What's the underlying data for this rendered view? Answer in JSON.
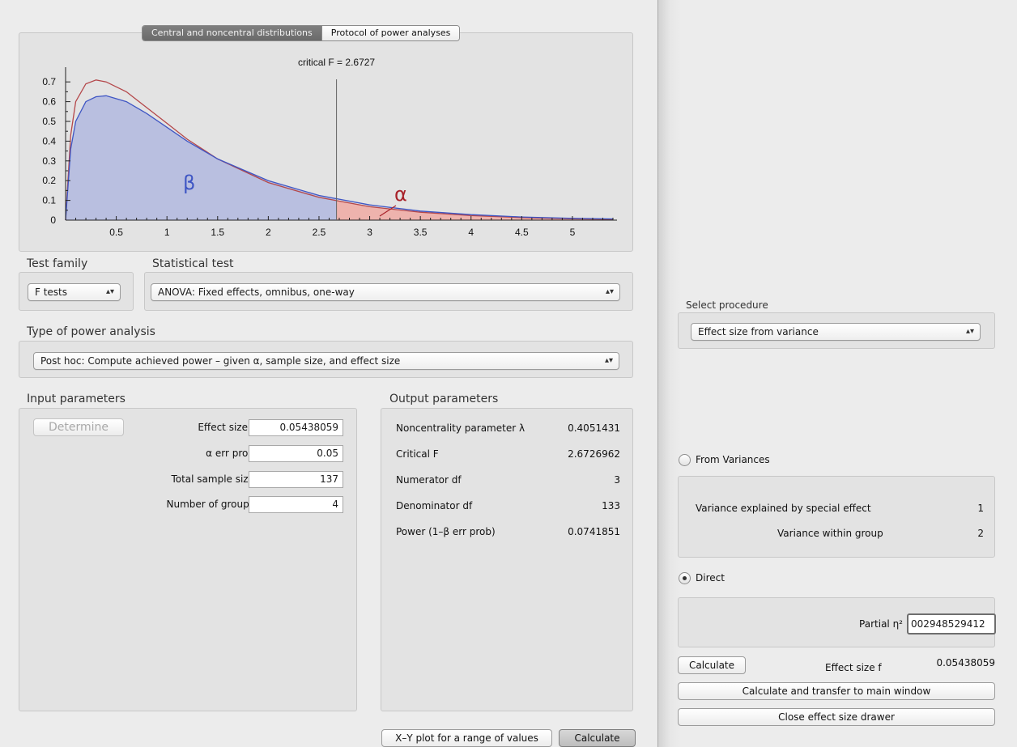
{
  "plot": {
    "tabs": [
      "Central and noncentral distributions",
      "Protocol of power analyses"
    ],
    "critical_label": "critical F = 2.6727",
    "beta_symbol": "β",
    "alpha_symbol": "α",
    "colors": {
      "central_curve": "#b4474a",
      "noncentral_curve": "#3f56c4",
      "beta_fill": "#b9bfe0",
      "alpha_fill": "#eeb3ad"
    }
  },
  "chart_data": {
    "type": "area",
    "title": "",
    "xlabel": "",
    "ylabel": "",
    "xlim": [
      0,
      5.4
    ],
    "ylim": [
      0,
      0.75
    ],
    "x_ticks": [
      "0.5",
      "1",
      "1.5",
      "2",
      "2.5",
      "3",
      "3.5",
      "4",
      "4.5",
      "5"
    ],
    "y_ticks": [
      "0",
      "0.1",
      "0.2",
      "0.3",
      "0.4",
      "0.5",
      "0.6",
      "0.7"
    ],
    "critical_value": 2.6727,
    "series": [
      {
        "name": "",
        "x": [
          0.0,
          0.05,
          0.1,
          0.2,
          0.3,
          0.4,
          0.6,
          0.8,
          1.0,
          1.2,
          1.5,
          2.0,
          2.5,
          3.0,
          3.5,
          4.0,
          4.5,
          5.0,
          5.4
        ],
        "values": [
          0.0,
          0.43,
          0.6,
          0.69,
          0.71,
          0.7,
          0.65,
          0.57,
          0.49,
          0.41,
          0.31,
          0.19,
          0.115,
          0.068,
          0.04,
          0.023,
          0.013,
          0.007,
          0.004
        ]
      },
      {
        "name": "",
        "x": [
          0.0,
          0.05,
          0.1,
          0.2,
          0.3,
          0.4,
          0.6,
          0.8,
          1.0,
          1.2,
          1.5,
          2.0,
          2.5,
          3.0,
          3.5,
          4.0,
          4.5,
          5.0,
          5.4
        ],
        "values": [
          0.0,
          0.36,
          0.5,
          0.6,
          0.625,
          0.63,
          0.6,
          0.54,
          0.47,
          0.4,
          0.31,
          0.2,
          0.125,
          0.077,
          0.046,
          0.028,
          0.016,
          0.009,
          0.006
        ]
      }
    ]
  },
  "test_family": {
    "label": "Test family",
    "value": "F tests"
  },
  "statistical_test": {
    "label": "Statistical test",
    "value": "ANOVA: Fixed effects, omnibus, one-way"
  },
  "power_analysis": {
    "label": "Type of power analysis",
    "value": "Post hoc: Compute achieved power – given α, sample size, and effect size"
  },
  "input": {
    "title": "Input parameters",
    "determine_label": "Determine",
    "rows": [
      {
        "label": "Effect size f",
        "value": "0.05438059"
      },
      {
        "label": "α err prob",
        "value": "0.05"
      },
      {
        "label": "Total sample size",
        "value": "137"
      },
      {
        "label": "Number of groups",
        "value": "4"
      }
    ]
  },
  "output": {
    "title": "Output parameters",
    "rows": [
      {
        "label": "Noncentrality parameter λ",
        "value": "0.4051431"
      },
      {
        "label": "Critical F",
        "value": "2.6726962"
      },
      {
        "label": "Numerator df",
        "value": "3"
      },
      {
        "label": "Denominator df",
        "value": "133"
      },
      {
        "label": "Power (1–β err prob)",
        "value": "0.0741851"
      }
    ]
  },
  "bottom_buttons": {
    "xy_plot": "X–Y plot for a range of values",
    "calculate": "Calculate"
  },
  "drawer": {
    "select_procedure_label": "Select procedure",
    "procedure_value": "Effect size from variance",
    "from_variances": {
      "label": "From Variances",
      "selected": false,
      "rows": [
        {
          "label": "Variance explained by special effect",
          "value": "1"
        },
        {
          "label": "Variance within group",
          "value": "2"
        }
      ]
    },
    "direct": {
      "label": "Direct",
      "selected": true,
      "partial_eta_label": "Partial η²",
      "partial_eta_value": "002948529412"
    },
    "calculate_label": "Calculate",
    "effect_size_label": "Effect size f",
    "effect_size_value": "0.05438059",
    "transfer_label": "Calculate and transfer to main window",
    "close_label": "Close effect size drawer"
  }
}
